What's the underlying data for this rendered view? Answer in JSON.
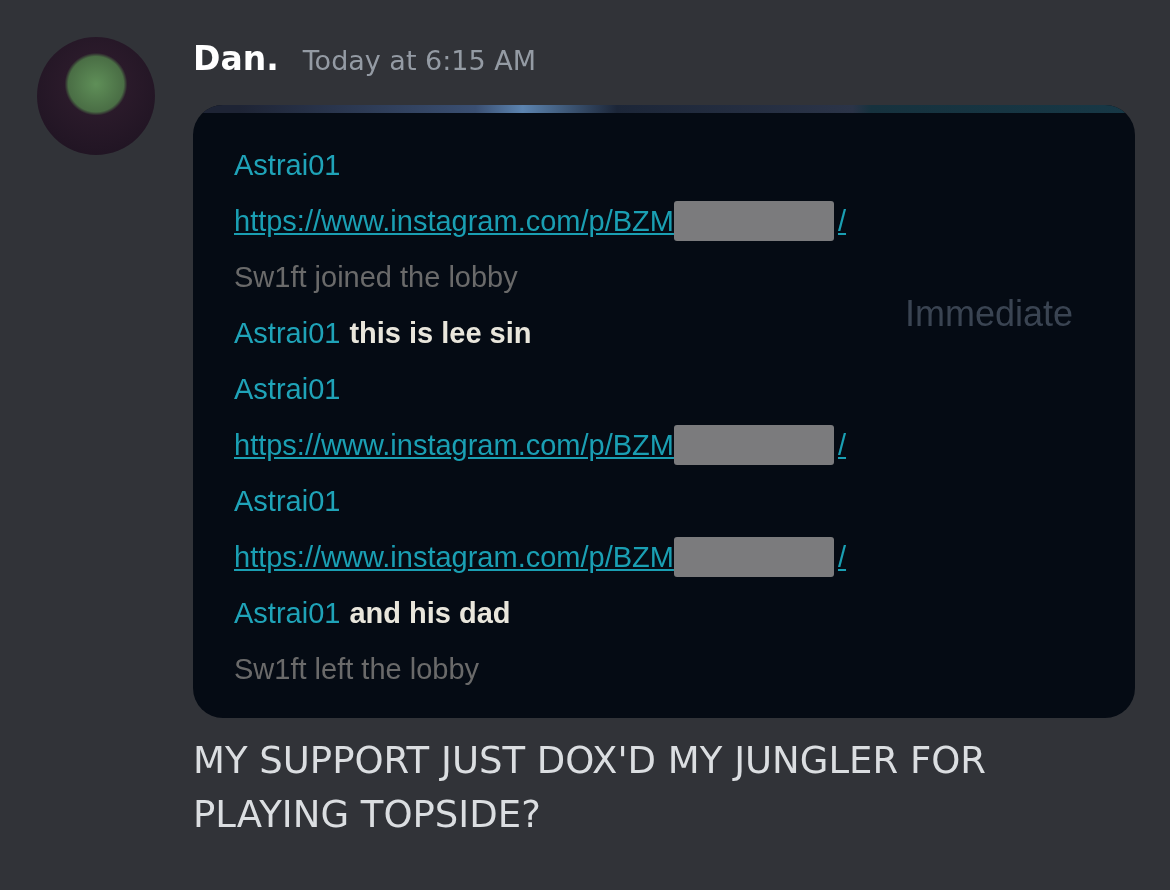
{
  "message": {
    "author": "Dan.",
    "timestamp": "Today at 6:15 AM",
    "body": "MY SUPPORT JUST DOX'D MY JUNGLER FOR PLAYING TOPSIDE?"
  },
  "screenshot": {
    "background_text": "Immediate",
    "lines": [
      {
        "kind": "name",
        "name": "Astrai01"
      },
      {
        "kind": "link",
        "text": "https://www.instagram.com/p/BZM",
        "suffix": "/"
      },
      {
        "kind": "system",
        "text": "Sw1ft joined the lobby"
      },
      {
        "kind": "message",
        "name": "Astrai01",
        "text": "this is lee sin"
      },
      {
        "kind": "name",
        "name": "Astrai01"
      },
      {
        "kind": "link",
        "text": "https://www.instagram.com/p/BZM",
        "suffix": "/"
      },
      {
        "kind": "name",
        "name": "Astrai01"
      },
      {
        "kind": "link",
        "text": "https://www.instagram.com/p/BZM",
        "suffix": "/"
      },
      {
        "kind": "message",
        "name": "Astrai01",
        "text": "and his dad"
      },
      {
        "kind": "system",
        "text": "Sw1ft left the lobby"
      }
    ]
  }
}
